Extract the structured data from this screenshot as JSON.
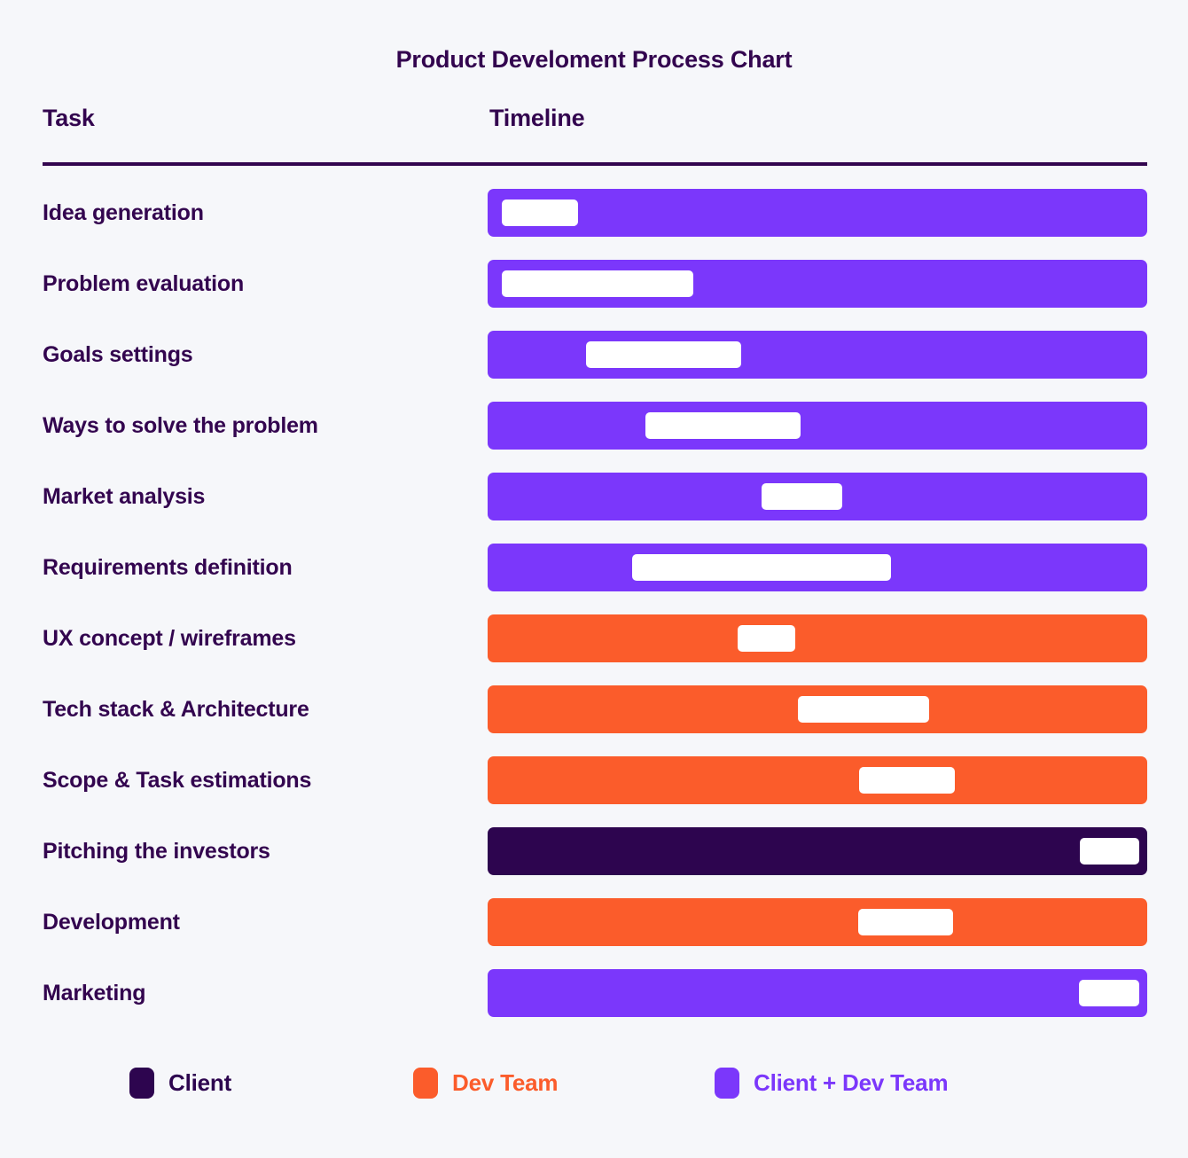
{
  "title": "Product Develoment Process Chart",
  "header": {
    "task_label": "Task",
    "timeline_label": "Timeline"
  },
  "colors": {
    "background": "#f6f7fa",
    "dark_purple": "#2d054f",
    "orange": "#fb5c2b",
    "violet": "#7b37fb",
    "marker": "#ffffff",
    "text": "#33054f"
  },
  "legend": [
    {
      "label": "Client",
      "color": "#2d054f",
      "key": "client"
    },
    {
      "label": "Dev Team",
      "color": "#fb5c2b",
      "key": "dev-team"
    },
    {
      "label": "Client + Dev Team",
      "color": "#7b37fb",
      "key": "client-dev-team"
    }
  ],
  "chart_data": {
    "type": "bar",
    "subtype": "gantt",
    "title": "Product Develoment Process Chart",
    "xlabel": "Timeline",
    "ylabel": "Task",
    "grid": false,
    "legend_position": "bottom",
    "track_span": [
      0,
      100
    ],
    "owners": {
      "client": {
        "label": "Client",
        "color": "#2d054f"
      },
      "dev-team": {
        "label": "Dev Team",
        "color": "#fb5c2b"
      },
      "client-dev-team": {
        "label": "Client + Dev Team",
        "color": "#7b37fb"
      }
    },
    "categories": [
      "Idea generation",
      "Problem evaluation",
      "Goals settings",
      "Ways to solve the problem",
      "Market analysis",
      "Requirements definition",
      "UX concept / wireframes",
      "Tech stack & Architecture",
      "Scope & Task estimations",
      "Pitching the investors",
      "Development",
      "Marketing"
    ],
    "rows": [
      {
        "task": "Idea generation",
        "owner": "client-dev-team",
        "color": "#7b37fb",
        "start_pct": 2.2,
        "end_pct": 13.7
      },
      {
        "task": "Problem evaluation",
        "owner": "client-dev-team",
        "color": "#7b37fb",
        "start_pct": 2.2,
        "end_pct": 31.2
      },
      {
        "task": "Goals settings",
        "owner": "client-dev-team",
        "color": "#7b37fb",
        "start_pct": 14.9,
        "end_pct": 38.4
      },
      {
        "task": "Ways to solve the problem",
        "owner": "client-dev-team",
        "color": "#7b37fb",
        "start_pct": 23.9,
        "end_pct": 47.4
      },
      {
        "task": "Market analysis",
        "owner": "client-dev-team",
        "color": "#7b37fb",
        "start_pct": 41.5,
        "end_pct": 53.8
      },
      {
        "task": "Requirements definition",
        "owner": "client-dev-team",
        "color": "#7b37fb",
        "start_pct": 21.9,
        "end_pct": 61.2
      },
      {
        "task": "UX concept / wireframes",
        "owner": "dev-team",
        "color": "#fb5c2b",
        "start_pct": 37.9,
        "end_pct": 46.6
      },
      {
        "task": "Tech stack & Architecture",
        "owner": "dev-team",
        "color": "#fb5c2b",
        "start_pct": 47.0,
        "end_pct": 66.9
      },
      {
        "task": "Scope & Task estimations",
        "owner": "dev-team",
        "color": "#fb5c2b",
        "start_pct": 56.3,
        "end_pct": 70.8
      },
      {
        "task": "Pitching the investors",
        "owner": "client",
        "color": "#2d054f",
        "start_pct": 89.8,
        "end_pct": 98.8
      },
      {
        "task": "Development",
        "owner": "dev-team",
        "color": "#fb5c2b",
        "start_pct": 56.2,
        "end_pct": 70.6
      },
      {
        "task": "Marketing",
        "owner": "client-dev-team",
        "color": "#7b37fb",
        "start_pct": 89.7,
        "end_pct": 98.8
      }
    ]
  }
}
